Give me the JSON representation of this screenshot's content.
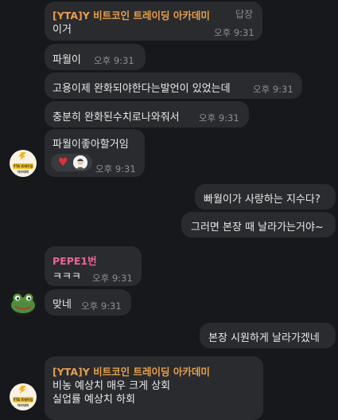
{
  "messages": [
    {
      "sender": "[YTA]Y 비트코인 트레이딩 아카데미",
      "reply_label": "답장",
      "text": "이거",
      "time": "오후 9:31"
    },
    {
      "text": "파월이",
      "time": "오후 9:31"
    },
    {
      "text": "고용이제 완화되야한다는발언이 있었는데",
      "time": "오후 9:31"
    },
    {
      "text": "충분히 완화된수치로나와줘서",
      "time": "오후 9:31"
    },
    {
      "text": "파월이좋아할거임",
      "time": "오후 9:31"
    },
    {
      "text": "빠월이가 사랑하는 지수다?"
    },
    {
      "text": "그러면 본장 때 날라가는거야~"
    },
    {
      "sender": "PEPE1번",
      "text": "ㅋㅋㅋ",
      "time": "오후 9:31"
    },
    {
      "text": "맞네",
      "time": "오후 9:31"
    },
    {
      "text": "본장 시원하게 날라가겠네"
    },
    {
      "sender": "[YTA]Y 비트코인 트레이딩 아카데미",
      "lines": [
        "비농 예상치 매우 크게 상회",
        "실업률 예상치 하회"
      ]
    }
  ],
  "avatar_label": "YTA 트레이딩 아카데미"
}
